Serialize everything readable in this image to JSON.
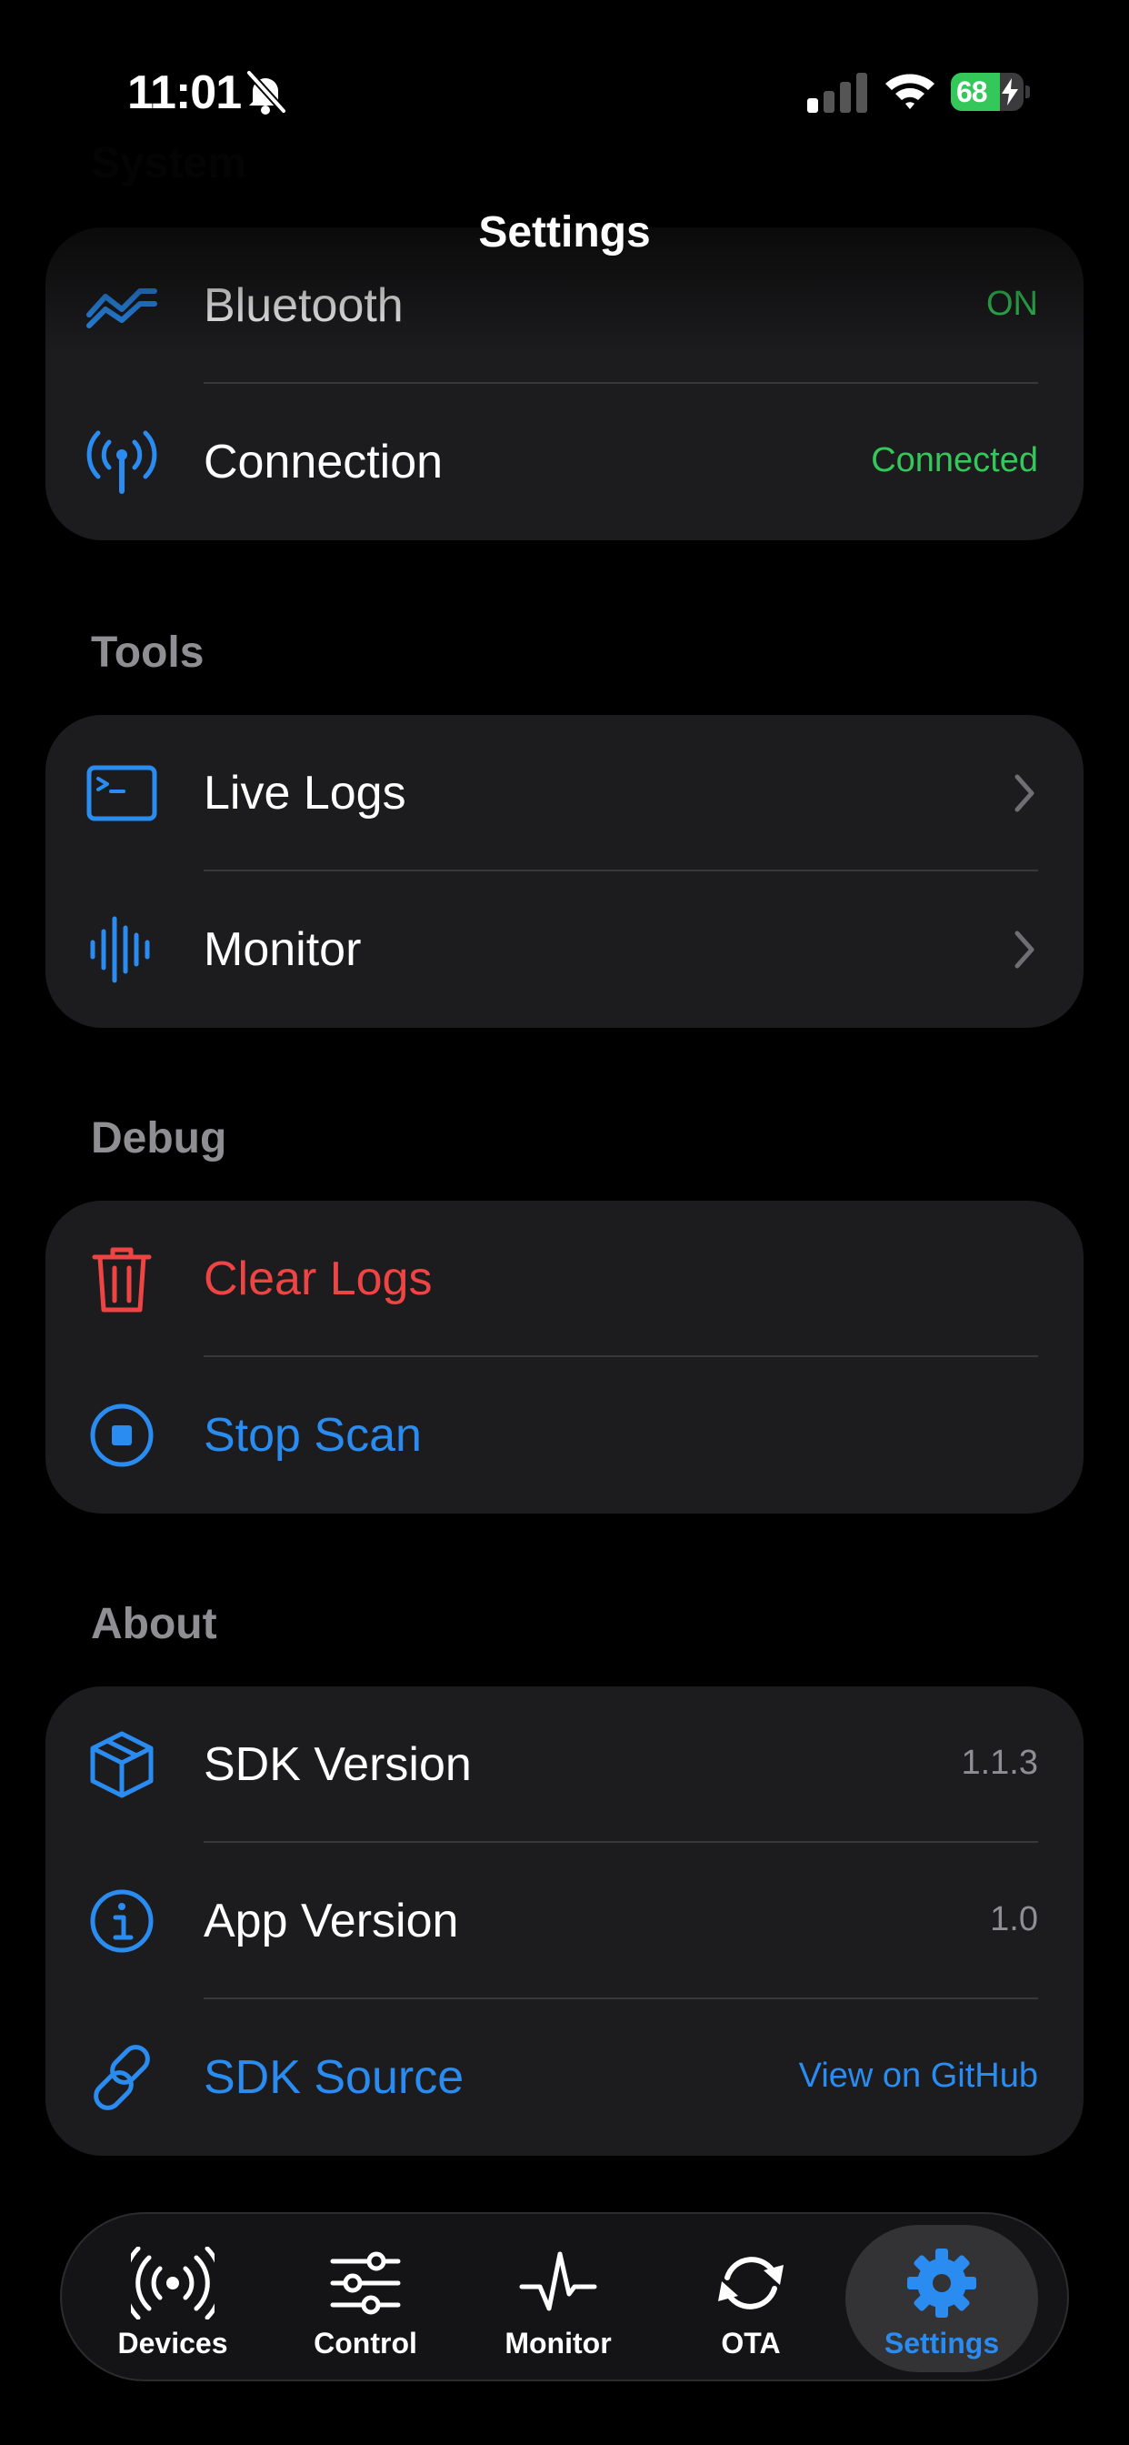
{
  "status_bar": {
    "time": "11:01",
    "battery": "68",
    "battery_level": 0.68
  },
  "nav": {
    "title": "Settings"
  },
  "sections": {
    "system": {
      "header": "System",
      "rows": {
        "bluetooth": {
          "label": "Bluetooth",
          "value": "ON",
          "icon": "bluetooth-wave-icon"
        },
        "connection": {
          "label": "Connection",
          "value": "Connected",
          "icon": "antenna-icon"
        }
      }
    },
    "tools": {
      "header": "Tools",
      "rows": {
        "live_logs": {
          "label": "Live Logs",
          "icon": "terminal-icon"
        },
        "monitor": {
          "label": "Monitor",
          "icon": "waveform-icon"
        }
      }
    },
    "debug": {
      "header": "Debug",
      "rows": {
        "clear_logs": {
          "label": "Clear Logs",
          "icon": "trash-icon"
        },
        "stop_scan": {
          "label": "Stop Scan",
          "icon": "stop-circle-icon"
        }
      }
    },
    "about": {
      "header": "About",
      "rows": {
        "sdk_version": {
          "label": "SDK Version",
          "value": "1.1.3",
          "icon": "cube-icon"
        },
        "app_version": {
          "label": "App Version",
          "value": "1.0",
          "icon": "info-icon"
        },
        "sdk_source": {
          "label": "SDK Source",
          "value": "View on GitHub",
          "icon": "link-icon"
        }
      }
    }
  },
  "tab_bar": {
    "devices": "Devices",
    "control": "Control",
    "monitor": "Monitor",
    "ota": "OTA",
    "settings": "Settings"
  },
  "colors": {
    "accent": "#2a8cf0",
    "destructive": "#ef4444",
    "success": "#34c759",
    "card": "#1c1c1e",
    "background": "#000000"
  }
}
